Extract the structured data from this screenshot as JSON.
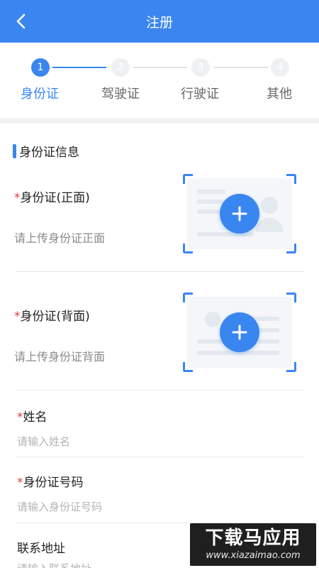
{
  "header": {
    "title": "注册",
    "back_icon": "chevron-left-icon"
  },
  "steps": [
    {
      "number": "1",
      "label": "身份证",
      "active": true
    },
    {
      "number": "2",
      "label": "驾驶证",
      "active": false
    },
    {
      "number": "3",
      "label": "行驶证",
      "active": false
    },
    {
      "number": "4",
      "label": "其他",
      "active": false
    }
  ],
  "section": {
    "title": "身份证信息"
  },
  "id_front": {
    "required_mark": "*",
    "label": "身份证(正面)",
    "hint": "请上传身份证正面"
  },
  "id_back": {
    "required_mark": "*",
    "label": "身份证(背面)",
    "hint": "请上传身份证背面"
  },
  "name_field": {
    "required_mark": "*",
    "label": "姓名",
    "placeholder": "请输入姓名"
  },
  "id_number_field": {
    "required_mark": "*",
    "label": "身份证号码",
    "placeholder": "请输入身份证号码"
  },
  "address_field": {
    "label": "联系地址",
    "placeholder": "请输入联系地址"
  },
  "watermark": {
    "main": "下载马应用",
    "sub": "www.xiazaimao.com"
  },
  "colors": {
    "primary": "#3a86f0",
    "required": "#e23c3c"
  }
}
